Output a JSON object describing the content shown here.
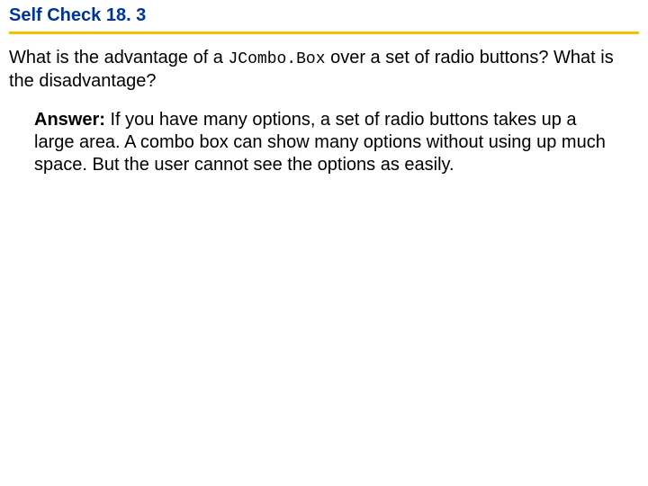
{
  "title": "Self Check 18. 3",
  "question": {
    "part1": "What is the advantage of a ",
    "code": "JCombo.Box",
    "part2": " over a set of radio buttons? What is the disadvantage?"
  },
  "answer": {
    "label": "Answer:",
    "text": " If you have many options, a set of radio buttons takes up a large area. A combo box can show many options without using up much space. But the user cannot see the options as easily."
  }
}
